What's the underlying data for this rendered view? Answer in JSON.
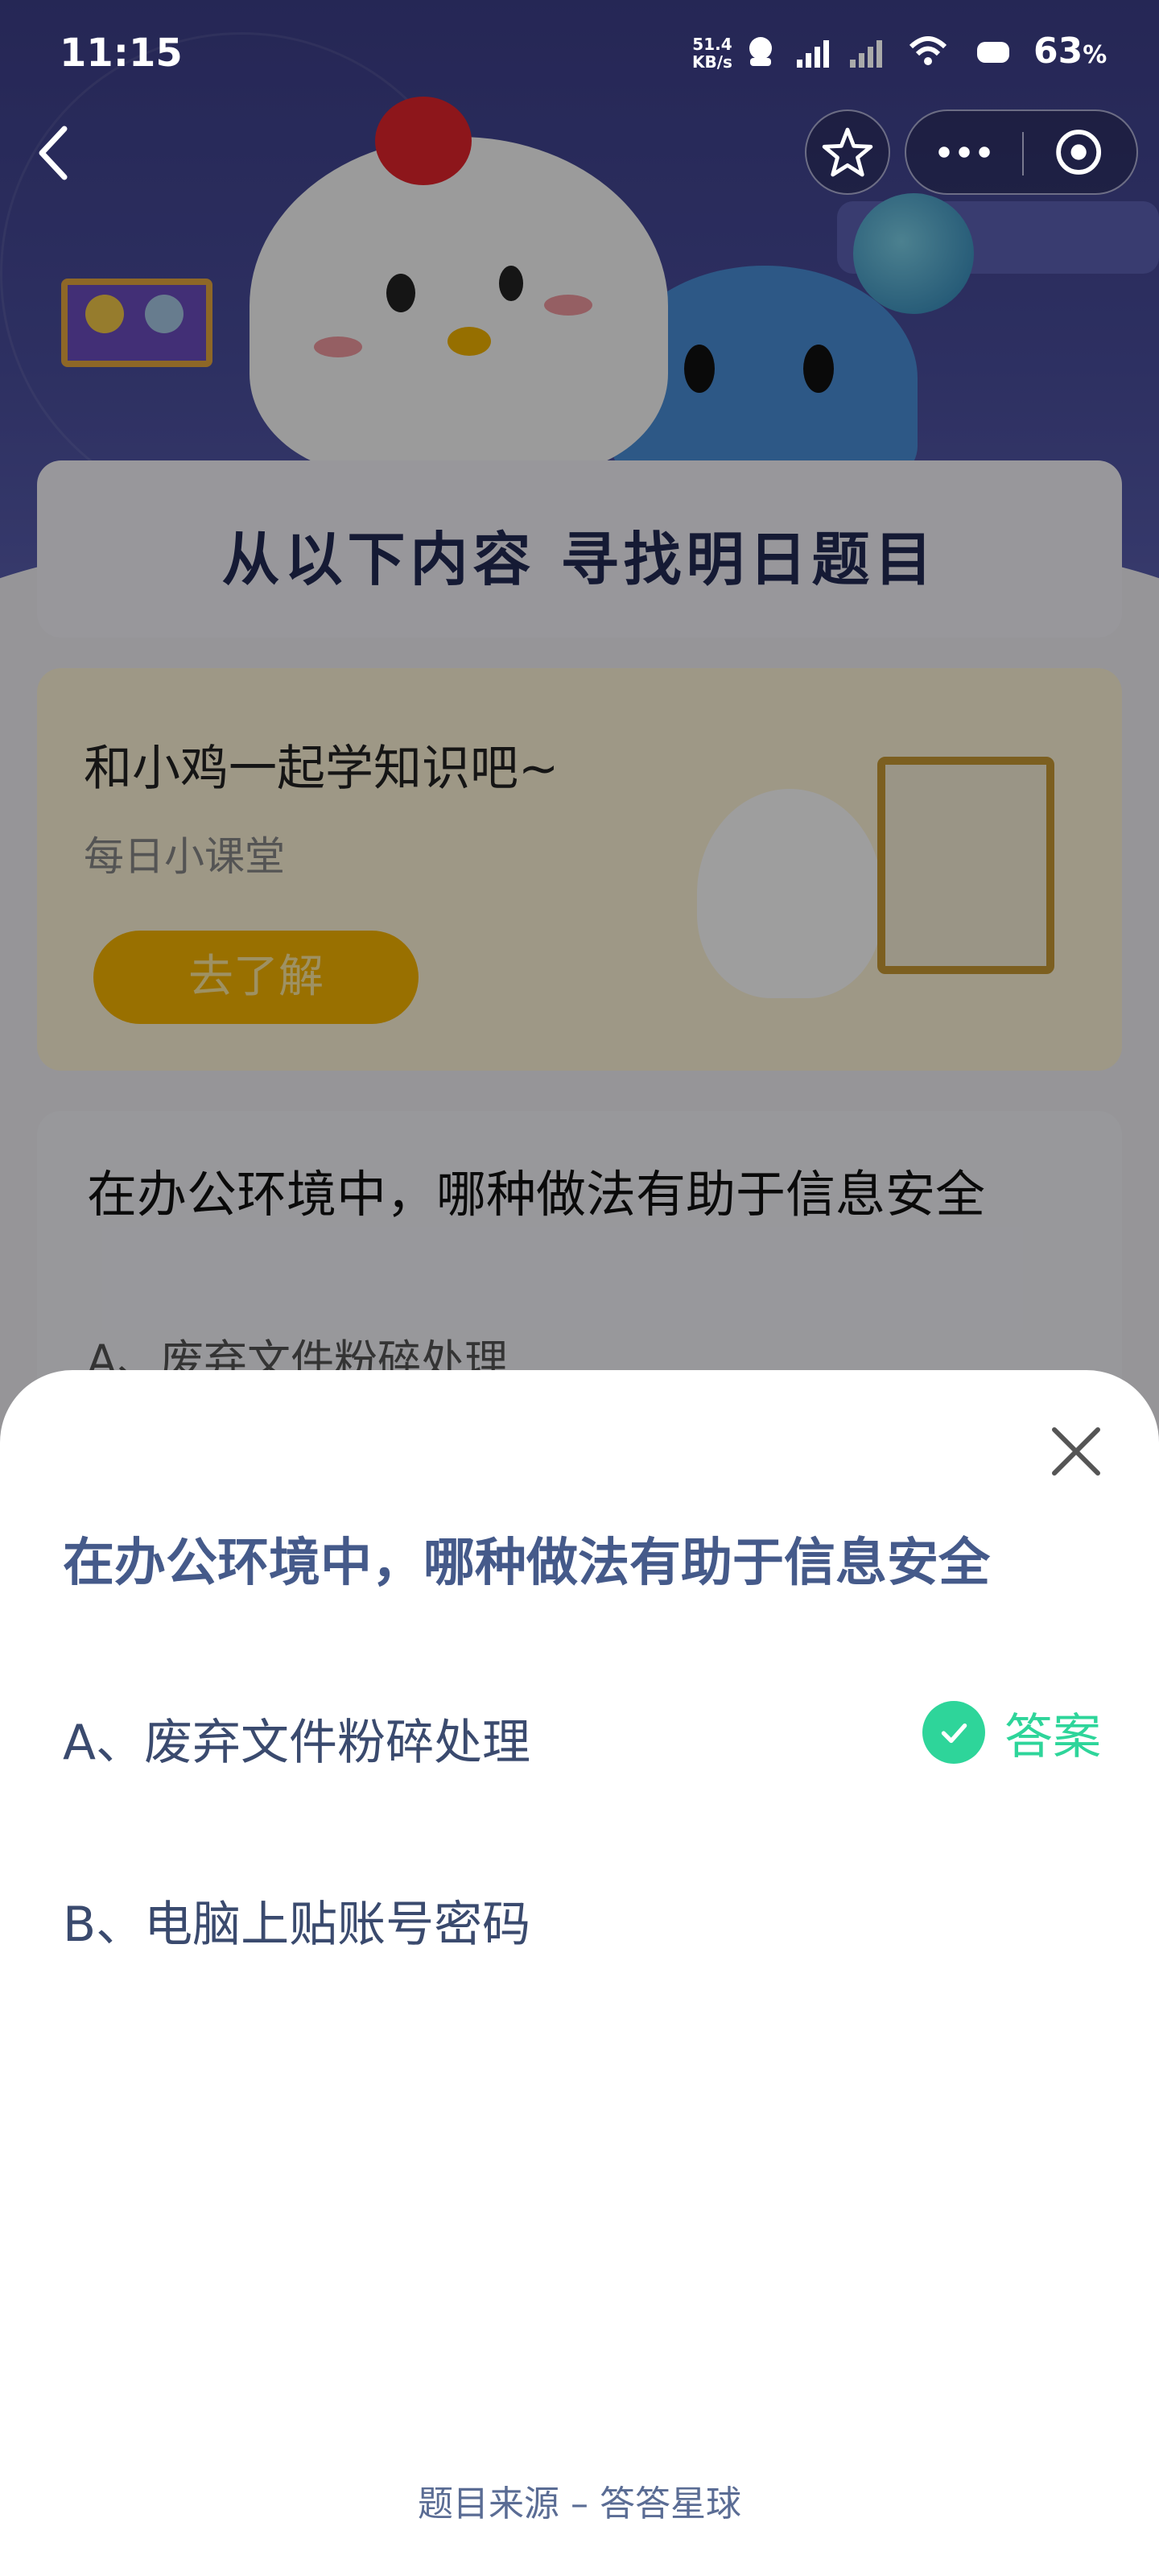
{
  "status_bar": {
    "time": "11:15",
    "net_speed_value": "51.4",
    "net_speed_unit": "KB/s",
    "battery": "63",
    "battery_unit": "%"
  },
  "nav": {
    "back_icon": "chevron-left-icon",
    "favorite_icon": "star-outline-icon",
    "more_icon": "more-dots-icon",
    "close_icon": "target-circle-icon"
  },
  "background": {
    "banner_title": "从以下内容  寻找明日题目",
    "learn_card": {
      "title": "和小鸡一起学知识吧~",
      "subtitle": "每日小课堂",
      "button": "去了解"
    },
    "question_card": {
      "title": "在办公环境中，哪种做法有助于信息安全",
      "option_a": "A、废弃文件粉碎处理"
    }
  },
  "sheet": {
    "question": "在办公环境中，哪种做法有助于信息安全",
    "options": [
      {
        "text": "A、废弃文件粉碎处理",
        "is_answer": true,
        "answer_label": "答案"
      },
      {
        "text": "B、电脑上贴账号密码",
        "is_answer": false
      }
    ],
    "source": "题目来源 – 答答星球",
    "colors": {
      "question": "#455a8a",
      "answer": "#2ed59a",
      "option": "#3a4a6e"
    }
  }
}
